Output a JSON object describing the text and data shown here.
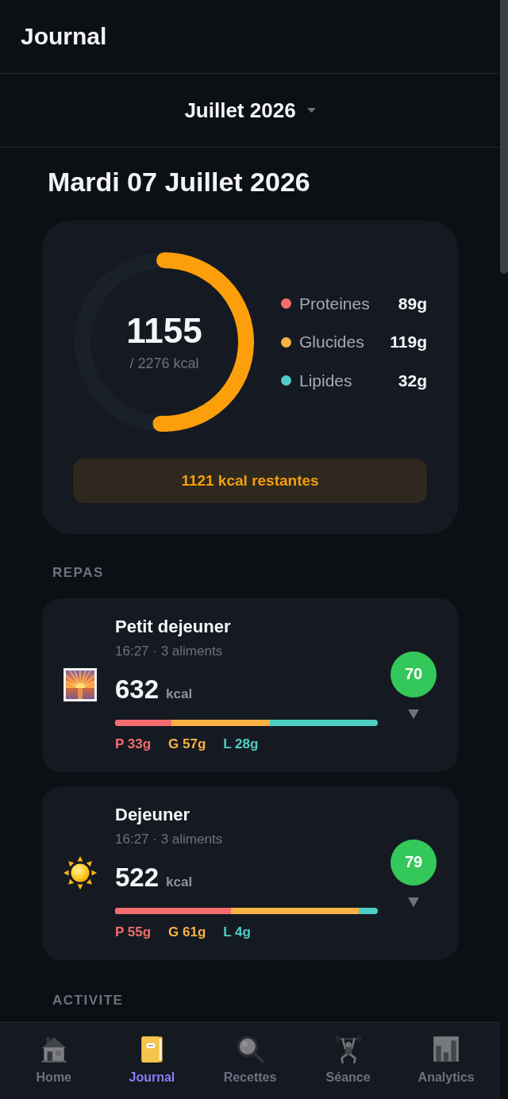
{
  "header": {
    "title": "Journal"
  },
  "month_selector": {
    "label": "Juillet 2026"
  },
  "date_title": "Mardi 07 Juillet 2026",
  "summary": {
    "consumed": "1155",
    "goal": "/ 2276 kcal",
    "level": 0.507,
    "macros": [
      {
        "name": "Proteines",
        "value": "89g",
        "color": "#f76c6c"
      },
      {
        "name": "Glucides",
        "value": "119g",
        "color": "#f9b243"
      },
      {
        "name": "Lipides",
        "value": "32g",
        "color": "#4ecdc4"
      }
    ],
    "remaining": "1121 kcal restantes"
  },
  "meals_section": {
    "title": "REPAS"
  },
  "meals": [
    {
      "kind": "sunrise",
      "title": "Petit dejeuner",
      "meta": "16:27 · 3 aliments",
      "kcal": "632",
      "unit": "kcal",
      "score": "70",
      "expanded": false,
      "bar_fills": [
        {
          "kind": "fill",
          "level": 0.216,
          "color": "#f76c6c"
        },
        {
          "kind": "fill",
          "level": 0.589,
          "color": "#f9b243"
        },
        {
          "kind": "rest",
          "color": "#4ecdc4"
        }
      ],
      "macros": [
        {
          "label": "P 33g",
          "color": "#f76c6c"
        },
        {
          "label": "G 57g",
          "color": "#f9b243"
        },
        {
          "label": "L 28g",
          "color": "#4ecdc4"
        }
      ]
    },
    {
      "kind": "sun",
      "title": "Dejeuner",
      "meta": "16:27 · 3 aliments",
      "kcal": "522",
      "unit": "kcal",
      "score": "79",
      "expanded": false,
      "bar_fills": [
        {
          "kind": "fill",
          "level": 0.44,
          "color": "#f76c6c"
        },
        {
          "kind": "fill",
          "level": 0.928,
          "color": "#f9b243"
        },
        {
          "kind": "rest",
          "color": "#4ecdc4"
        }
      ],
      "macros": [
        {
          "label": "P 55g",
          "color": "#f76c6c"
        },
        {
          "label": "G 61g",
          "color": "#f9b243"
        },
        {
          "label": "L 4g",
          "color": "#4ecdc4"
        }
      ]
    }
  ],
  "activity_section": {
    "title": "ACTIVITE"
  },
  "nav": {
    "items": [
      {
        "label": "Home",
        "kind": "home",
        "selected": false
      },
      {
        "label": "Journal",
        "kind": "journal",
        "selected": true
      },
      {
        "label": "Recettes",
        "kind": "recipes",
        "selected": false
      },
      {
        "label": "Séance",
        "kind": "workout",
        "selected": false
      },
      {
        "label": "Analytics",
        "kind": "analytics",
        "selected": false
      }
    ]
  }
}
